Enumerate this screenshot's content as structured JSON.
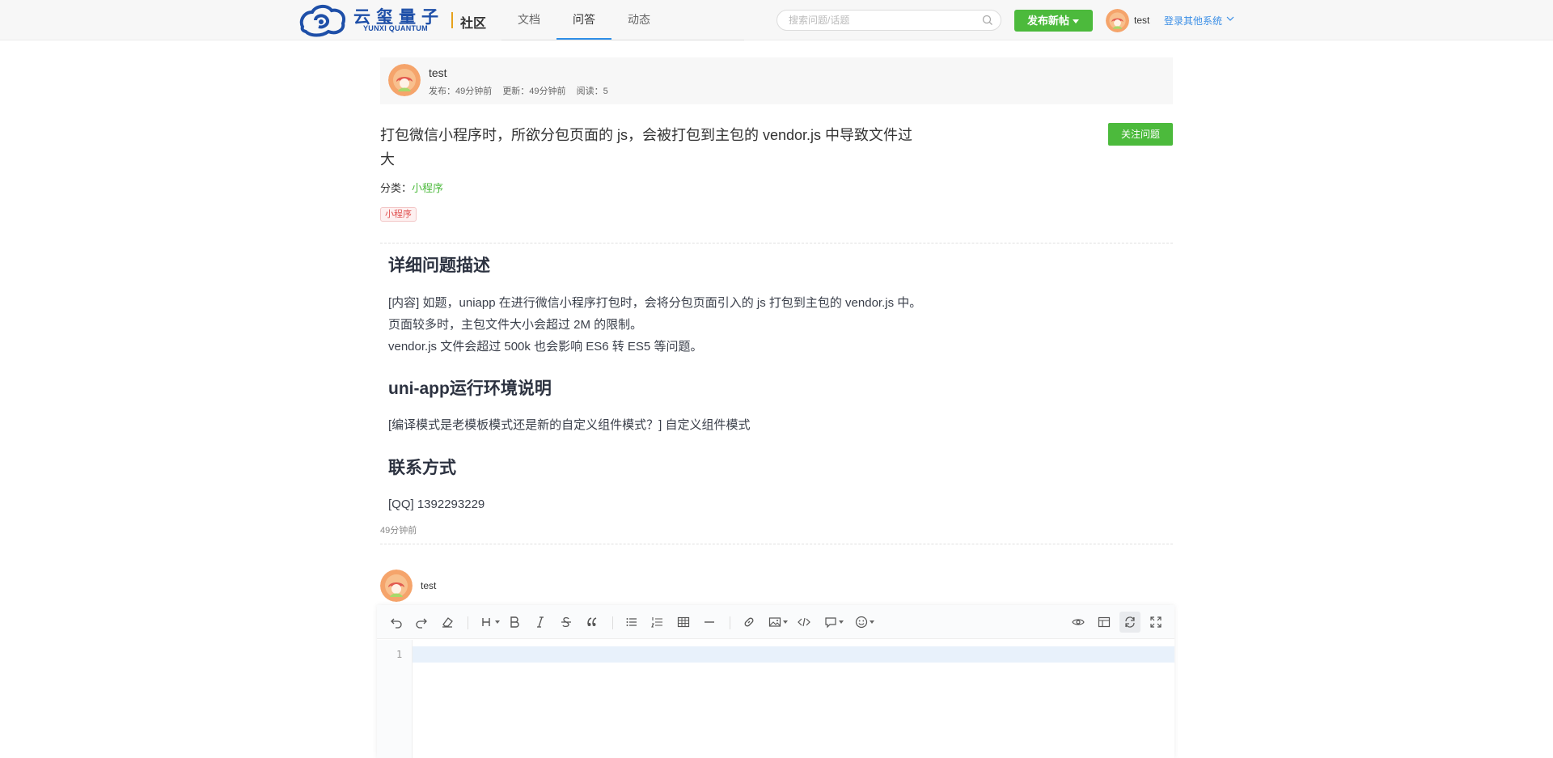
{
  "header": {
    "brand_cn": "云玺量子",
    "brand_en": "YUNXI QUANTUM",
    "community": "社区",
    "nav": [
      {
        "label": "文档"
      },
      {
        "label": "问答"
      },
      {
        "label": "动态"
      }
    ],
    "search_placeholder": "搜索问题/话题",
    "post_button": "发布新帖",
    "username": "test",
    "login_other": "登录其他系统"
  },
  "question": {
    "author": "test",
    "published_label": "发布：49分钟前",
    "updated_label": "更新：49分钟前",
    "reads_label": "阅读：5",
    "title": "打包微信小程序时，所欲分包页面的 js，会被打包到主包的 vendor.js 中导致文件过大",
    "follow_button": "关注问题",
    "category_label": "分类：",
    "category_value": "小程序",
    "tag": "小程序",
    "sections": {
      "s1_heading": "详细问题描述",
      "s1_line1": "[内容] 如题，uniapp 在进行微信小程序打包时，会将分包页面引入的 js 打包到主包的 vendor.js 中。",
      "s1_line2": "页面较多时，主包文件大小会超过 2M 的限制。",
      "s1_line3": "vendor.js 文件会超过 500k 也会影响 ES6 转 ES5 等问题。",
      "s2_heading": "uni-app运行环境说明",
      "s2_line1": "[编译模式是老模板模式还是新的自定义组件模式？] 自定义组件模式",
      "s3_heading": "联系方式",
      "s3_line1": "[QQ] 1392293229"
    },
    "time": "49分钟前"
  },
  "answer": {
    "username": "test",
    "line_number": "1"
  },
  "colors": {
    "accent_green": "#4cba3c",
    "brand_blue": "#1e4fa8",
    "link_blue": "#3a8ee6",
    "tag_red": "#e0504f"
  }
}
